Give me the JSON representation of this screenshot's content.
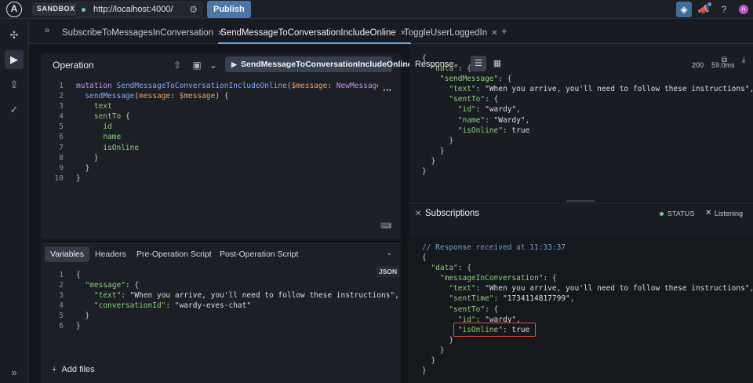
{
  "topbar": {
    "sandbox_label": "SANDBOX",
    "url": "http://localhost:4000/",
    "publish_label": "Publish",
    "avatar_initial": "n"
  },
  "tabs": [
    {
      "label": "SubscribeToMessagesInConversation",
      "active": false
    },
    {
      "label": "SendMessageToConversationIncludeOnline",
      "active": true
    },
    {
      "label": "ToggleUserLoggedIn",
      "active": false
    }
  ],
  "operation": {
    "title": "Operation",
    "run_label": "SendMessageToConversationIncludeOnline",
    "line_numbers": [
      "1",
      "2",
      "3",
      "4",
      "5",
      "6",
      "7",
      "8",
      "9",
      "10"
    ]
  },
  "variables_panel": {
    "tabs": [
      "Variables",
      "Headers",
      "Pre-Operation Script",
      "Post-Operation Script"
    ],
    "json_badge": "JSON",
    "line_numbers": [
      "1",
      "2",
      "3",
      "4",
      "5",
      "6"
    ],
    "add_files_label": "Add files"
  },
  "response": {
    "label": "Response",
    "status_code": "200",
    "time": "59.0ms"
  },
  "subscriptions": {
    "title": "Subscriptions",
    "status_label": "STATUS",
    "listening_label": "Listening",
    "comment": "// Response received at 11:33:37"
  }
}
